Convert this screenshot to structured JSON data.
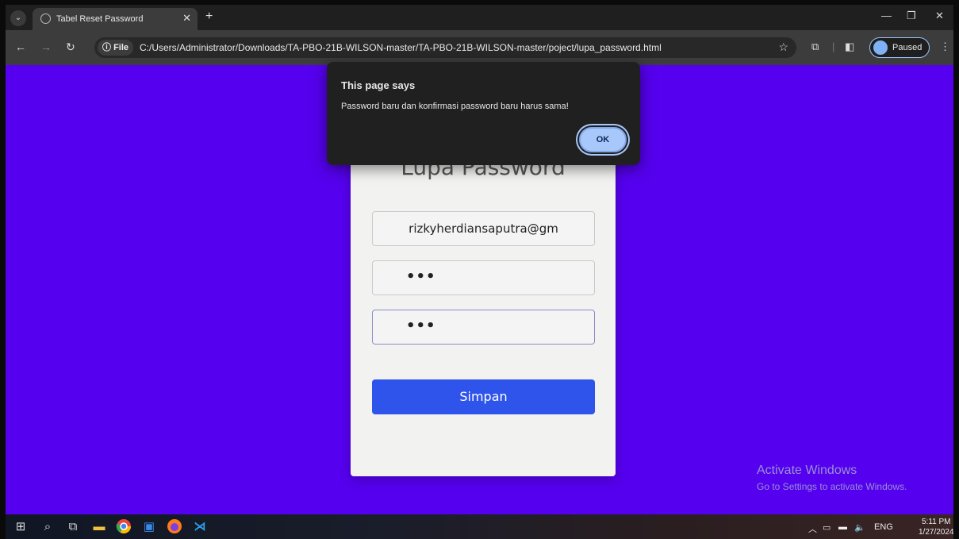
{
  "browser": {
    "tab_title": "Tabel Reset Password",
    "url_chip": "File",
    "url": "C:/Users/Administrator/Downloads/TA-PBO-21B-WILSON-master/TA-PBO-21B-WILSON-master/poject/lupa_password.html",
    "profile_label": "Paused"
  },
  "dialog": {
    "title": "This page says",
    "message": "Password baru dan konfirmasi password baru harus sama!",
    "ok_label": "OK"
  },
  "form": {
    "heading": "Lupa Password",
    "email_value": "rizkyherdiansaputra@gm",
    "new_password_mask": "•••",
    "confirm_password_mask": "•••",
    "save_label": "Simpan"
  },
  "watermark": {
    "line1": "Activate Windows",
    "line2": "Go to Settings to activate Windows."
  },
  "taskbar": {
    "language": "ENG",
    "time": "5:11 PM",
    "date": "1/27/2024"
  },
  "colors": {
    "page_background": "#5500ee",
    "button": "#2f54eb",
    "dialog_ok": "#a8c7fa"
  }
}
